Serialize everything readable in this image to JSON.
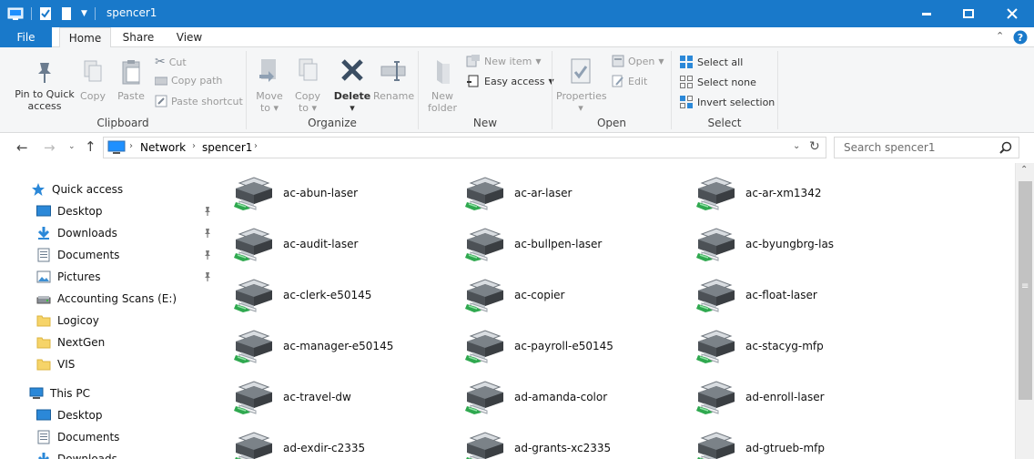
{
  "window": {
    "title": "spencer1",
    "minimize": "minimize",
    "maximize": "maximize",
    "close": "close"
  },
  "ribbon_tabs": [
    "File",
    "Home",
    "Share",
    "View"
  ],
  "ribbon": {
    "clipboard": {
      "label": "Clipboard",
      "pin_line1": "Pin to Quick",
      "pin_line2": "access",
      "copy": "Copy",
      "paste": "Paste",
      "cut": "Cut",
      "copy_path": "Copy path",
      "paste_shortcut": "Paste shortcut"
    },
    "organize": {
      "label": "Organize",
      "move_to": "Move",
      "move_to2": "to",
      "copy_to": "Copy",
      "copy_to2": "to",
      "delete": "Delete",
      "rename": "Rename"
    },
    "new": {
      "label": "New",
      "new_folder1": "New",
      "new_folder2": "folder",
      "new_item": "New item",
      "easy_access": "Easy access"
    },
    "open": {
      "label": "Open",
      "properties": "Properties",
      "open": "Open",
      "edit": "Edit"
    },
    "select": {
      "label": "Select",
      "select_all": "Select all",
      "select_none": "Select none",
      "invert": "Invert selection"
    }
  },
  "address": {
    "crumbs": [
      "Network",
      "spencer1"
    ],
    "search_placeholder": "Search spencer1"
  },
  "nav": {
    "quick_access": "Quick access",
    "quick_items": [
      {
        "label": "Desktop",
        "pinned": true
      },
      {
        "label": "Downloads",
        "pinned": true
      },
      {
        "label": "Documents",
        "pinned": true
      },
      {
        "label": "Pictures",
        "pinned": true
      },
      {
        "label": "Accounting Scans (E:)",
        "pinned": false
      },
      {
        "label": "Logicoy",
        "pinned": false
      },
      {
        "label": "NextGen",
        "pinned": false
      },
      {
        "label": "VIS",
        "pinned": false
      }
    ],
    "this_pc": "This PC",
    "pc_items": [
      "Desktop",
      "Documents",
      "Downloads"
    ]
  },
  "printers": [
    "ac-abun-laser",
    "ac-ar-laser",
    "ac-ar-xm1342",
    "ac-audit-laser",
    "ac-bullpen-laser",
    "ac-byungbrg-las",
    "ac-clerk-e50145",
    "ac-copier",
    "ac-float-laser",
    "ac-manager-e50145",
    "ac-payroll-e50145",
    "ac-stacyg-mfp",
    "ac-travel-dw",
    "ad-amanda-color",
    "ad-enroll-laser",
    "ad-exdir-c2335",
    "ad-grants-xc2335",
    "ad-gtrueb-mfp"
  ],
  "colors": {
    "title_bar": "#1979ca",
    "ribbon_bg": "#f5f6f7",
    "close_hover": "#e81123"
  }
}
